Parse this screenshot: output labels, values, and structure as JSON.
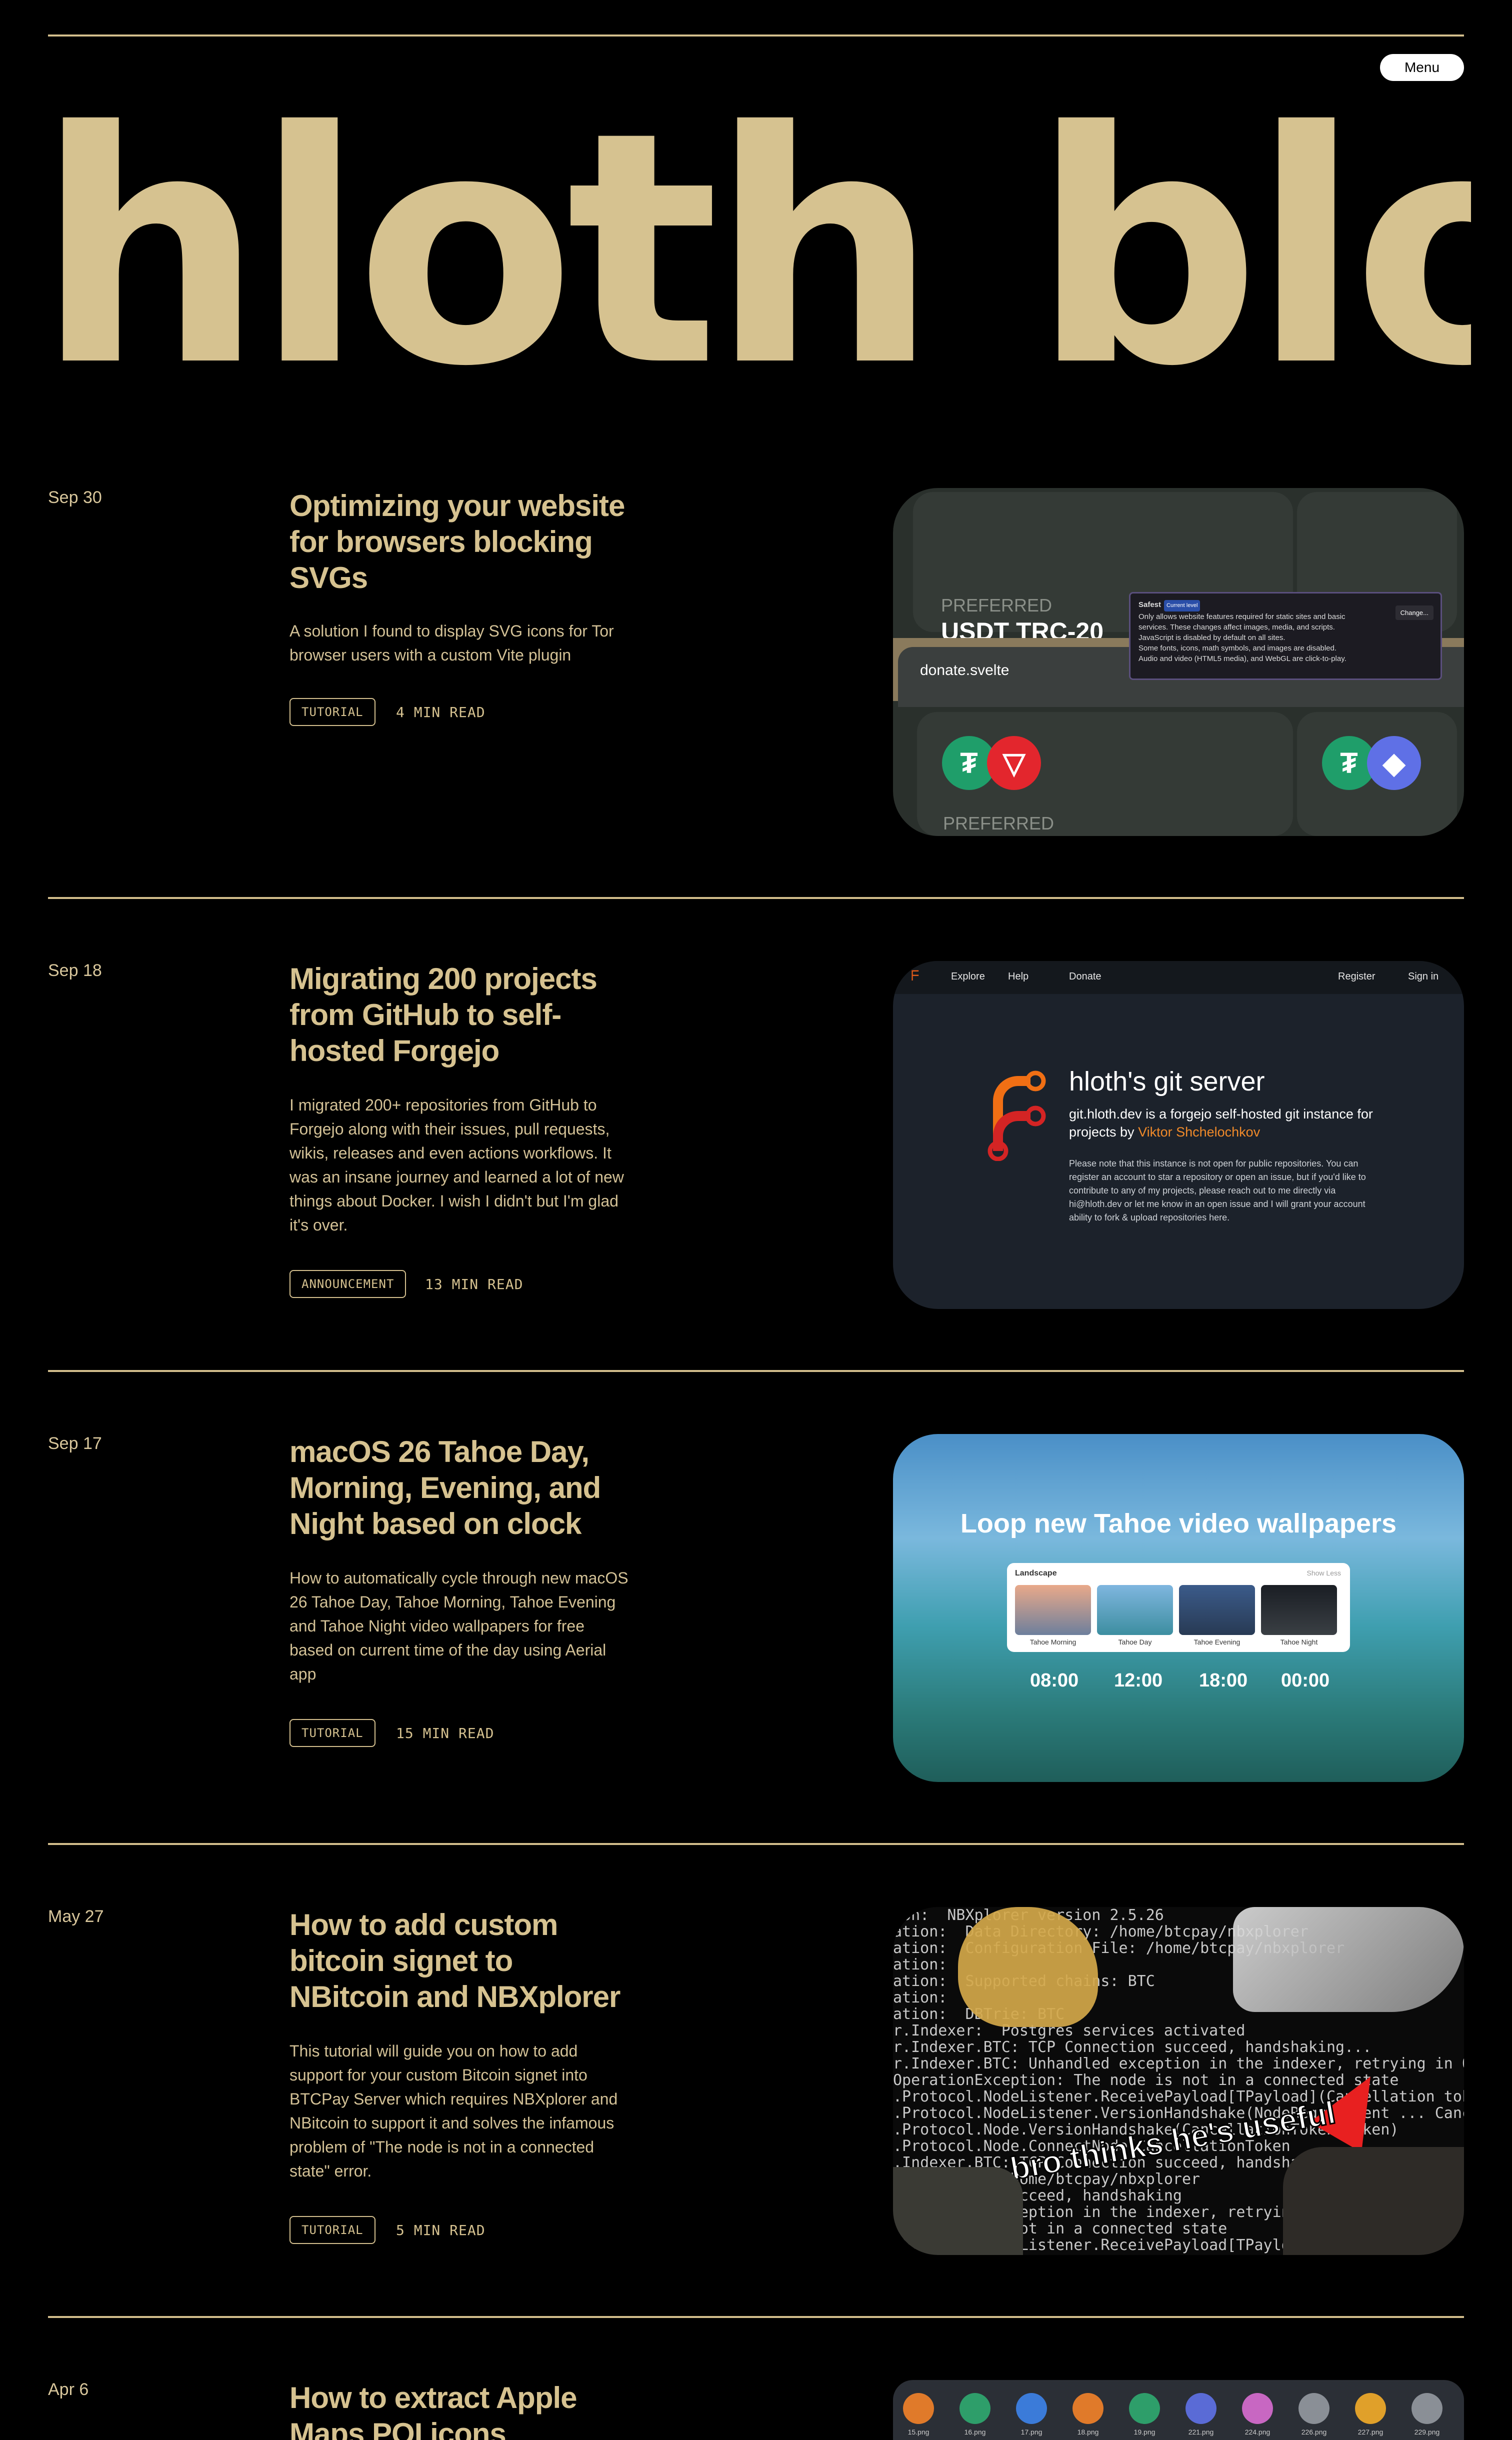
{
  "header": {
    "menu_label": "Menu",
    "hero_title": "hloth blog"
  },
  "posts": [
    {
      "date": "Sep 30",
      "title": "Optimizing your website for browsers blocking SVGs",
      "description": "A solution I found to display SVG icons for Tor browser users with a custom Vite plugin",
      "tag": "TUTORIAL",
      "read_time": "4 MIN READ",
      "thumb": {
        "preferred": "PREFERRED",
        "usdt_text": "USDT TRC-20",
        "bar_text": "donate.svelte",
        "popup_title": "Safest",
        "popup_badge": "Current level",
        "popup_text": "Only allows website features required for static sites and basic services. These changes affect images, media, and scripts.",
        "popup_items": [
          "JavaScript is disabled by default on all sites.",
          "Some fonts, icons, math symbols, and images are disabled.",
          "Audio and video (HTML5 media), and WebGL are click-to-play."
        ],
        "popup_button": "Change..."
      }
    },
    {
      "date": "Sep 18",
      "title": "Migrating 200 projects from GitHub to self-hosted Forgejo",
      "description": "I migrated 200+ repositories from GitHub to Forgejo along with their issues, pull requests, wikis, releases and even actions workflows. It was an insane journey and learned a lot of new things about Docker. I wish I didn't but I'm glad it's over.",
      "tag": "ANNOUNCEMENT",
      "read_time": "13 MIN READ",
      "thumb": {
        "nav_explore": "Explore",
        "nav_help": "Help",
        "nav_donate": "Donate",
        "nav_register": "Register",
        "nav_signin": "Sign in",
        "heading": "hloth's git server",
        "subheading_pre": "git.hloth.dev is a forgejo self-hosted git instance for projects by ",
        "subheading_name": "Viktor Shchelochkov",
        "note": "Please note that this instance is not open for public repositories. You can register an account to star a repository or open an issue, but if you'd like to contribute to any of my projects, please reach out to me directly via hi@hloth.dev or let me know in an open issue and I will grant your account ability to fork & upload repositories here."
      }
    },
    {
      "date": "Sep 17",
      "title": "macOS 26 Tahoe Day, Morning, Evening, and Night based on clock",
      "description": "How to automatically cycle through new macOS 26 Tahoe Day, Tahoe Morning, Tahoe Evening and Tahoe Night video wallpapers for free based on current time of the day using Aerial app",
      "tag": "TUTORIAL",
      "read_time": "15 MIN READ",
      "thumb": {
        "heading": "Loop new Tahoe video wallpapers",
        "panel_label": "Landscape",
        "panel_action": "Show Less",
        "tiles": [
          "Tahoe Morning",
          "Tahoe Day",
          "Tahoe Evening",
          "Tahoe Night"
        ],
        "times": [
          "08:00",
          "12:00",
          "18:00",
          "00:00"
        ]
      }
    },
    {
      "date": "May 27",
      "title": "How to add custom bitcoin signet to NBitcoin and NBXplorer",
      "description": "This tutorial will guide you on how to add support for your custom Bitcoin signet into BTCPay Server which requires NBXplorer and NBitcoin to support it and solves the infamous problem of \"The node is not in a connected state\" error.",
      "tag": "TUTORIAL",
      "read_time": "5 MIN READ",
      "thumb": {
        "log": "ion:  NBXplorer version 2.5.26\nation:  Data Directory: /home/btcpay/nbxplorer\nation:  Configuration File: /home/btcpay/nbxplorer\nation:\nation:  Supported chains: BTC\nation:\nation:  DBTrie: BTC\nr.Indexer:  Postgres services activated\nr.Indexer.BTC: TCP Connection succeed, handshaking...\nr.Indexer.BTC: Unhandled exception in the indexer, retrying in 0 seconds\nOperationException: The node is not in a connected state\n.Protocol.NodeListener.ReceivePayload[TPayload](Cancellation token cancell\n.Protocol.NodeListener.VersionHandshake(NodeRequirement ... CancellationToken\n.Protocol.Node.VersionHandshake(CancellationToken token)\n.Protocol.Node.ConnectNode(CancellationToken\n.Indexer.BTC: TCP Connection succeed, handsha\n.Directory: /home/btcpay/nbxplorer\n.Connection succeed, handshaking\n.Unhandled exception in the indexer, retrying in 0 seconds\n.The node is not in a connected state\n.Protocol.NodeListener.ReceivePayload[TPayload](Cancellation",
        "meme": "bro thinks he's useful"
      }
    },
    {
      "date": "Apr 6",
      "title": "How to extract Apple Maps POI icons symbols",
      "thumb": {
        "captions": [
          "15.png",
          "16.png",
          "17.png",
          "18.png",
          "19.png",
          "221.png",
          "224.png",
          "226.png",
          "227.png",
          "229.png"
        ],
        "colors": [
          "#e07a2a",
          "#2e9e6a",
          "#3b7bd9",
          "#e07a2a",
          "#2e9e6a",
          "#5a6bd6",
          "#c867c2",
          "#8a8f96",
          "#e0a02a",
          "#8a8f96"
        ]
      }
    }
  ]
}
